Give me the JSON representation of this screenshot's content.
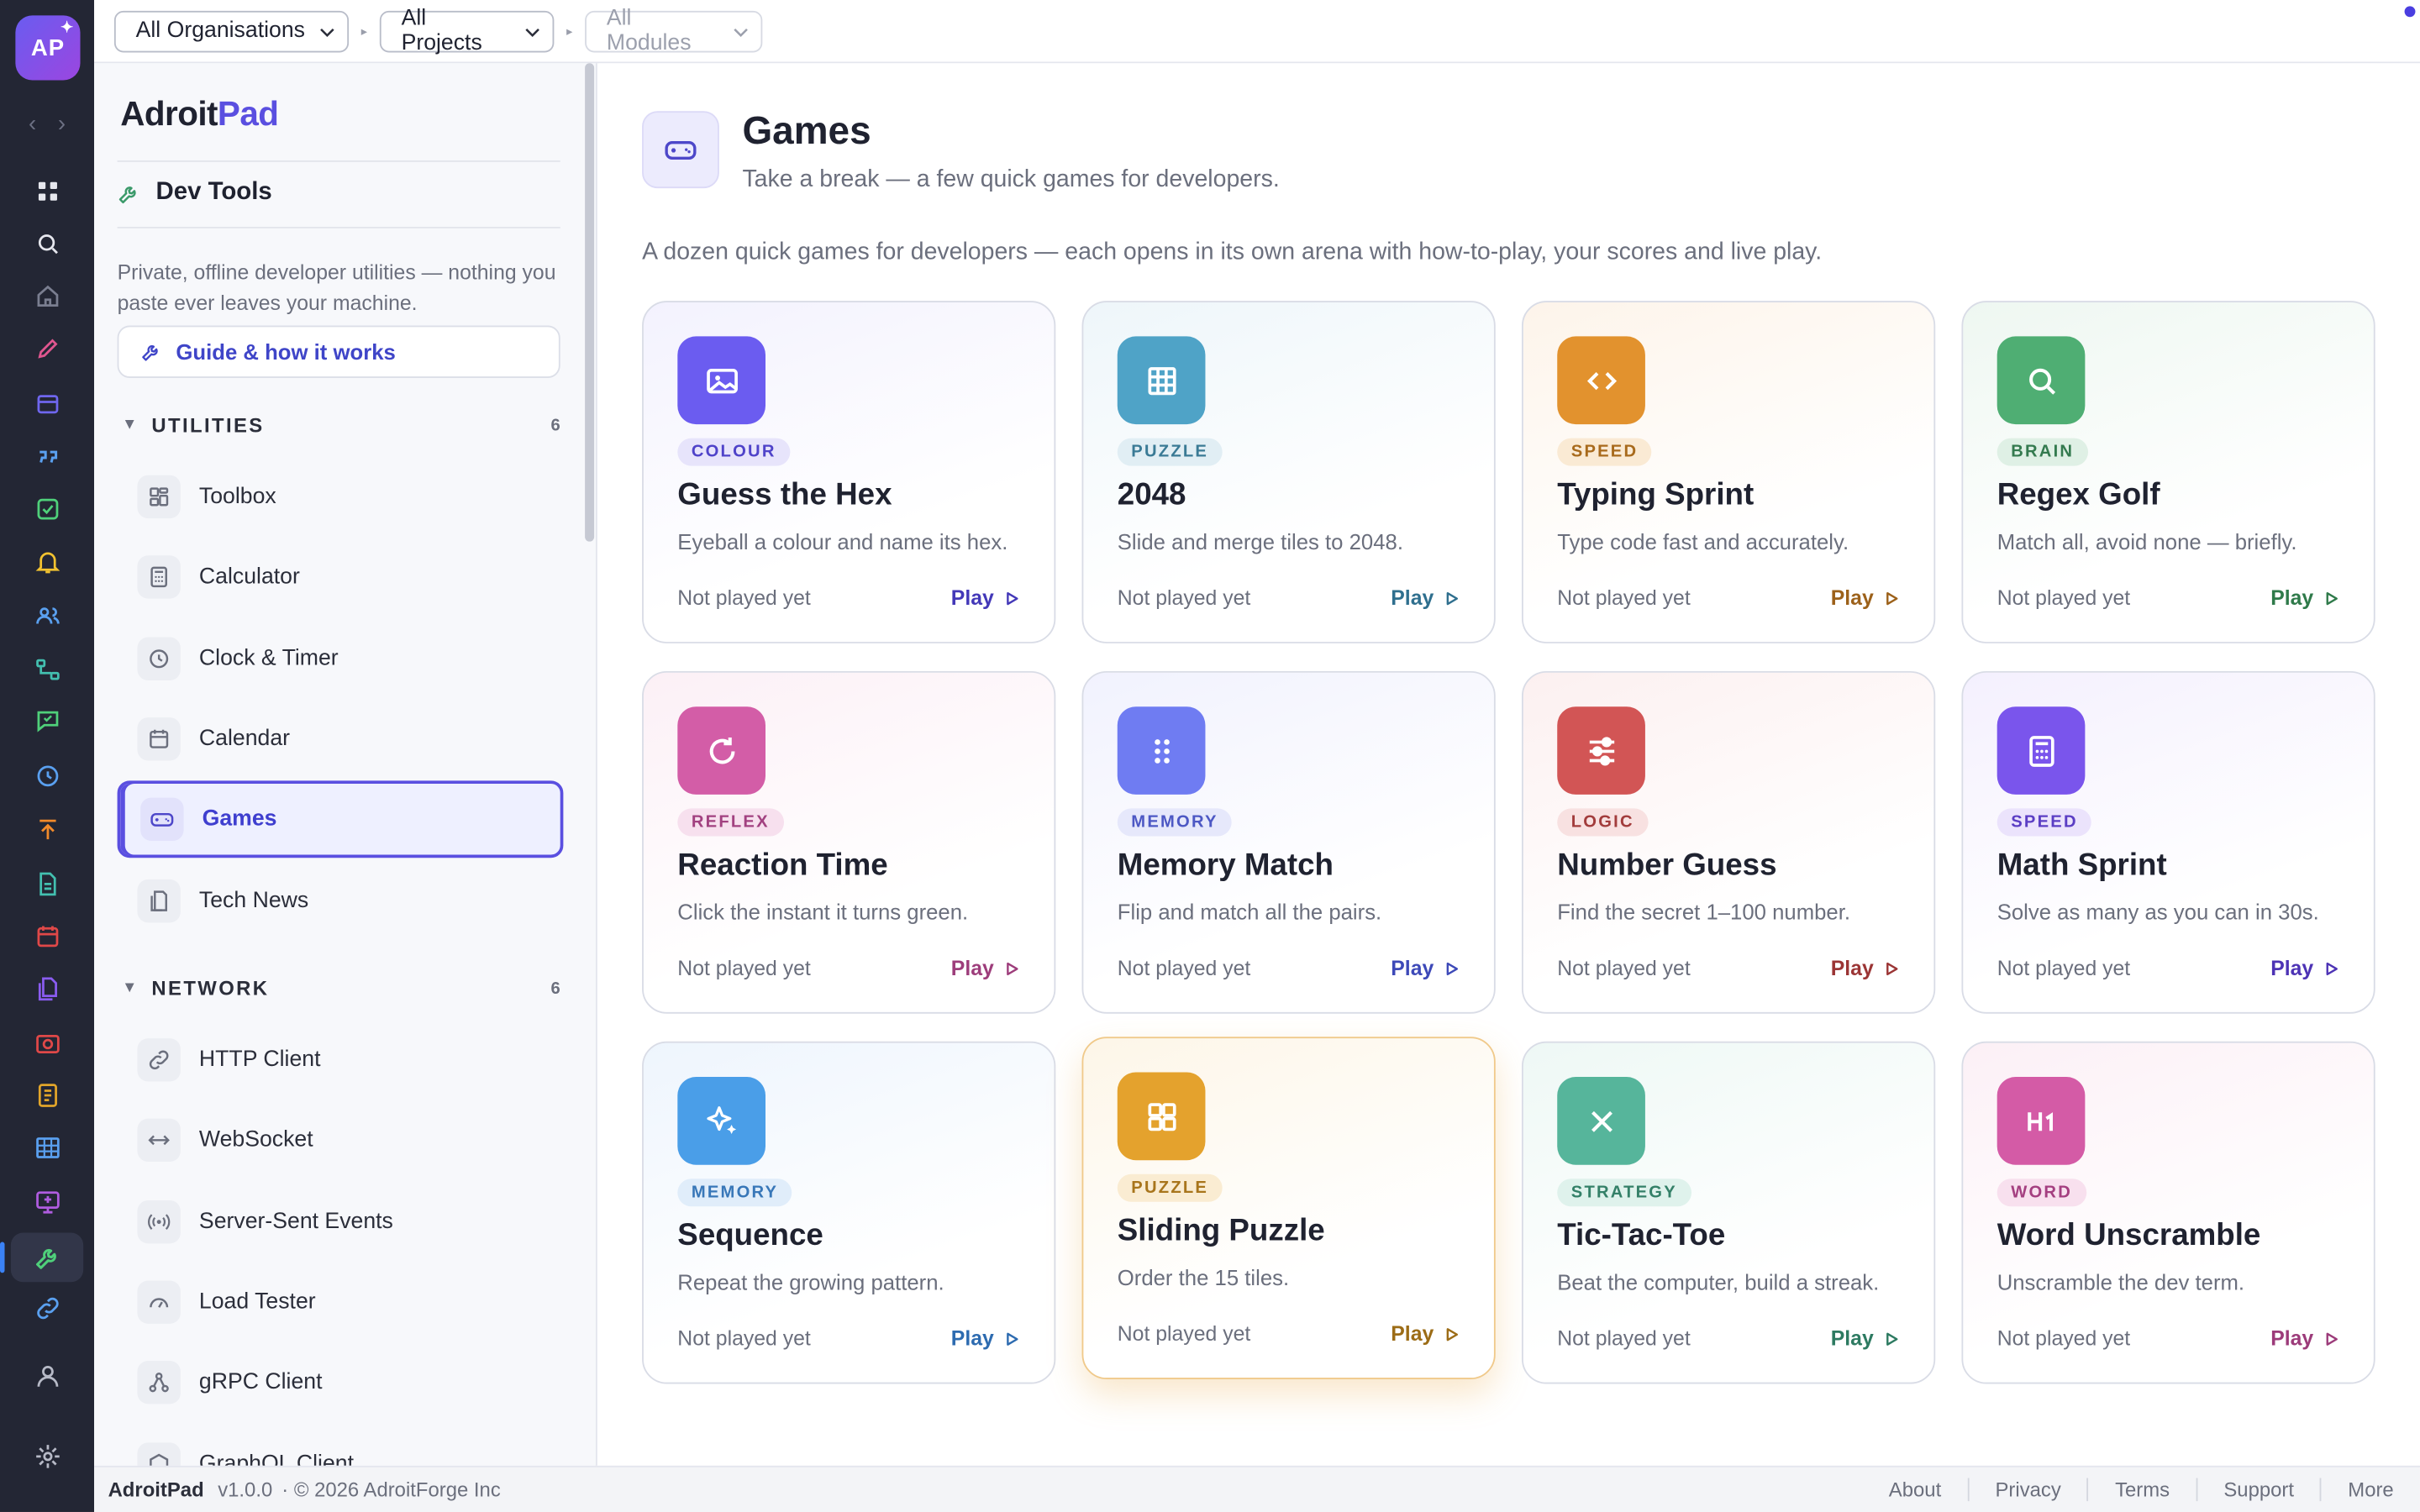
{
  "app": {
    "logo_text": "AP",
    "brand_a": "Adroit",
    "brand_b": "Pad"
  },
  "topbar": {
    "org": "All Organisations",
    "project": "All Projects",
    "module": "All Modules"
  },
  "rail_icons": [
    "apps-grid-icon",
    "search-icon",
    "home-icon",
    "pencil-icon",
    "inbox-icon",
    "quote-icon",
    "check-square-icon",
    "bell-icon",
    "users-icon",
    "flow-icon",
    "chat-icon",
    "clock-icon",
    "upload-icon",
    "document-icon",
    "calendar-icon",
    "files-icon",
    "camera-icon",
    "notebook-icon",
    "table-icon",
    "screen-icon",
    "wrench-icon",
    "link-icon",
    "user-icon",
    "gear-icon"
  ],
  "sidebar": {
    "section_title": "Dev Tools",
    "description": "Private, offline developer utilities — nothing you paste ever leaves your machine.",
    "guide_label": "Guide & how it works",
    "utilities": {
      "title": "UTILITIES",
      "count": "6",
      "items": [
        "Toolbox",
        "Calculator",
        "Clock & Timer",
        "Calendar",
        "Games",
        "Tech News"
      ]
    },
    "network": {
      "title": "NETWORK",
      "count": "6",
      "items": [
        "HTTP Client",
        "WebSocket",
        "Server-Sent Events",
        "Load Tester",
        "gRPC Client",
        "GraphQL Client"
      ]
    }
  },
  "page": {
    "title": "Games",
    "subtitle": "Take a break — a few quick games for developers.",
    "intro": "A dozen quick games for developers — each opens in its own arena with how-to-play, your scores and live play."
  },
  "games": [
    {
      "tag": "COLOUR",
      "title": "Guess the Hex",
      "desc": "Eyeball a colour and name its hex.",
      "status": "Not played yet",
      "play": "Play",
      "icon": "image-icon",
      "accent": "#6b5cf0",
      "tagbg": "#e7e4fb",
      "tagfg": "#4f43c9",
      "playfg": "#4338b8",
      "bg": "#f3f2fe"
    },
    {
      "tag": "PUZZLE",
      "title": "2048",
      "desc": "Slide and merge tiles to 2048.",
      "status": "Not played yet",
      "play": "Play",
      "icon": "grid-icon",
      "accent": "#4fa3c7",
      "tagbg": "#e1eef4",
      "tagfg": "#3a7a95",
      "playfg": "#2f6f8e",
      "bg": "#eef6fa"
    },
    {
      "tag": "SPEED",
      "title": "Typing Sprint",
      "desc": "Type code fast and accurately.",
      "status": "Not played yet",
      "play": "Play",
      "icon": "code-icon",
      "accent": "#e2922e",
      "tagbg": "#faead4",
      "tagfg": "#a86a1c",
      "playfg": "#9c611a",
      "bg": "#fdf4ea"
    },
    {
      "tag": "BRAIN",
      "title": "Regex Golf",
      "desc": "Match all, avoid none — briefly.",
      "status": "Not played yet",
      "play": "Play",
      "icon": "magnifier-icon",
      "accent": "#4fae73",
      "tagbg": "#dff0e5",
      "tagfg": "#347a4f",
      "playfg": "#2f7a4a",
      "bg": "#eef7f1"
    },
    {
      "tag": "REFLEX",
      "title": "Reaction Time",
      "desc": "Click the instant it turns green.",
      "status": "Not played yet",
      "play": "Play",
      "icon": "refresh-icon",
      "accent": "#d35da7",
      "tagbg": "#f7e0ee",
      "tagfg": "#a24180",
      "playfg": "#9d3d7b",
      "bg": "#fcf0f6"
    },
    {
      "tag": "MEMORY",
      "title": "Memory Match",
      "desc": "Flip and match all the pairs.",
      "status": "Not played yet",
      "play": "Play",
      "icon": "dots-icon",
      "accent": "#6f7cf2",
      "tagbg": "#e6e8fb",
      "tagfg": "#4d58c4",
      "playfg": "#3d49b8",
      "bg": "#f1f2fe"
    },
    {
      "tag": "LOGIC",
      "title": "Number Guess",
      "desc": "Find the secret 1–100 number.",
      "status": "Not played yet",
      "play": "Play",
      "icon": "sliders-icon",
      "accent": "#d25555",
      "tagbg": "#f8e1e1",
      "tagfg": "#a23c3c",
      "playfg": "#9b3535",
      "bg": "#fcf0f0"
    },
    {
      "tag": "SPEED",
      "title": "Math Sprint",
      "desc": "Solve as many as you can in 30s.",
      "status": "Not played yet",
      "play": "Play",
      "icon": "calculator-icon",
      "accent": "#7a55ec",
      "tagbg": "#ebe3fc",
      "tagfg": "#5b3ec4",
      "playfg": "#4d33b5",
      "bg": "#f4f0fe"
    },
    {
      "tag": "MEMORY",
      "title": "Sequence",
      "desc": "Repeat the growing pattern.",
      "status": "Not played yet",
      "play": "Play",
      "icon": "sparkle-icon",
      "accent": "#4a9ee8",
      "tagbg": "#e0edfa",
      "tagfg": "#3877b8",
      "playfg": "#2d6bb0",
      "bg": "#eef5fd"
    },
    {
      "tag": "PUZZLE",
      "title": "Sliding Puzzle",
      "desc": "Order the 15 tiles.",
      "status": "Not played yet",
      "play": "Play",
      "icon": "tiles-icon",
      "accent": "#e4a22d",
      "tagbg": "#faecd2",
      "tagfg": "#a8751c",
      "playfg": "#9c6c16",
      "bg": "#fdf6e8"
    },
    {
      "tag": "STRATEGY",
      "title": "Tic-Tac-Toe",
      "desc": "Beat the computer, build a streak.",
      "status": "Not played yet",
      "play": "Play",
      "icon": "x-icon",
      "accent": "#56b59b",
      "tagbg": "#dff2ec",
      "tagfg": "#348068",
      "playfg": "#2d7a61",
      "bg": "#eef8f5"
    },
    {
      "tag": "WORD",
      "title": "Word Unscramble",
      "desc": "Unscramble the dev term.",
      "status": "Not played yet",
      "play": "Play",
      "icon": "heading-icon",
      "accent": "#d45ba6",
      "tagbg": "#f8e0ee",
      "tagfg": "#a43f80",
      "playfg": "#9c3b7a",
      "bg": "#fcf0f6"
    }
  ],
  "footer": {
    "brand": "AdroitPad",
    "version": "v1.0.0",
    "copyright": "· © 2026 AdroitForge Inc",
    "links": [
      "About",
      "Privacy",
      "Terms",
      "Support",
      "More"
    ]
  }
}
